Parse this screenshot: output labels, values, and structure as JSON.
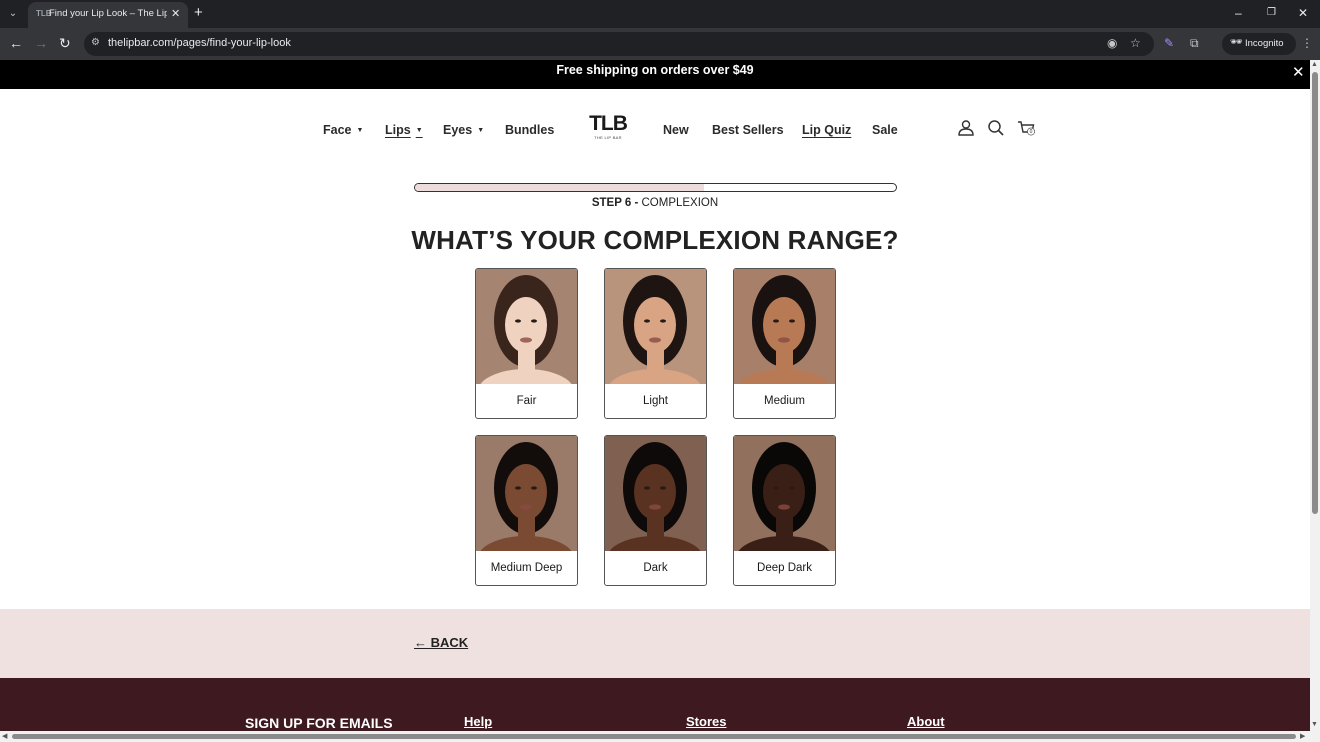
{
  "browser": {
    "tab_title": "Find your Lip Look – The Lip Ba",
    "tab_favicon": "TLB",
    "url": "thelipbar.com/pages/find-your-lip-look",
    "incognito_label": "Incognito",
    "icons": [
      "tab-search-icon",
      "close-icon",
      "plus-icon",
      "minimize-icon",
      "restore-icon",
      "back-icon",
      "forward-icon",
      "reload-icon",
      "site-info-icon",
      "eye-off-icon",
      "star-icon",
      "extension-icon",
      "puzzle-icon",
      "incognito-icon",
      "kebab-menu-icon"
    ]
  },
  "announcement": {
    "text": "Free shipping on orders over $49"
  },
  "nav": {
    "left": [
      {
        "label": "Face",
        "has_dropdown": true
      },
      {
        "label": "Lips",
        "has_dropdown": true,
        "active": true
      },
      {
        "label": "Eyes",
        "has_dropdown": true
      },
      {
        "label": "Bundles",
        "has_dropdown": false
      }
    ],
    "logo": {
      "main": "TLB",
      "sub": "THE LIP BAR"
    },
    "right": [
      {
        "label": "New"
      },
      {
        "label": "Best Sellers"
      },
      {
        "label": "Lip Quiz",
        "active": true
      },
      {
        "label": "Sale"
      }
    ],
    "cart_count": "0",
    "icons": [
      "account-icon",
      "search-icon",
      "cart-icon"
    ]
  },
  "quiz": {
    "progress_fraction": 0.6,
    "step_label": "STEP 6 -",
    "step_name": "COMPLEXION",
    "question": "WHAT’S YOUR COMPLEXION RANGE?",
    "options": [
      {
        "label": "Fair",
        "skin": "#f0d2c0",
        "hair": "#3a251c",
        "bg": "#a58472"
      },
      {
        "label": "Light",
        "skin": "#d9a483",
        "hair": "#1e1512",
        "bg": "#b8947d"
      },
      {
        "label": "Medium",
        "skin": "#b77a55",
        "hair": "#1a1210",
        "bg": "#a8806a"
      },
      {
        "label": "Medium Deep",
        "skin": "#7a4a33",
        "hair": "#120c0a",
        "bg": "#9a7a68"
      },
      {
        "label": "Dark",
        "skin": "#5a3222",
        "hair": "#0e0a09",
        "bg": "#806050"
      },
      {
        "label": "Deep Dark",
        "skin": "#3a1f16",
        "hair": "#0a0807",
        "bg": "#92705e"
      }
    ],
    "back_label": "← BACK"
  },
  "footer": {
    "signup_heading": "SIGN UP FOR EMAILS",
    "links": [
      "Help",
      "Stores",
      "About"
    ]
  },
  "colors": {
    "announcement_bg": "#000000",
    "progress_fill": "#ecdcdc",
    "back_band_bg": "#efe1e0",
    "footer_bg": "#3e1a20"
  }
}
